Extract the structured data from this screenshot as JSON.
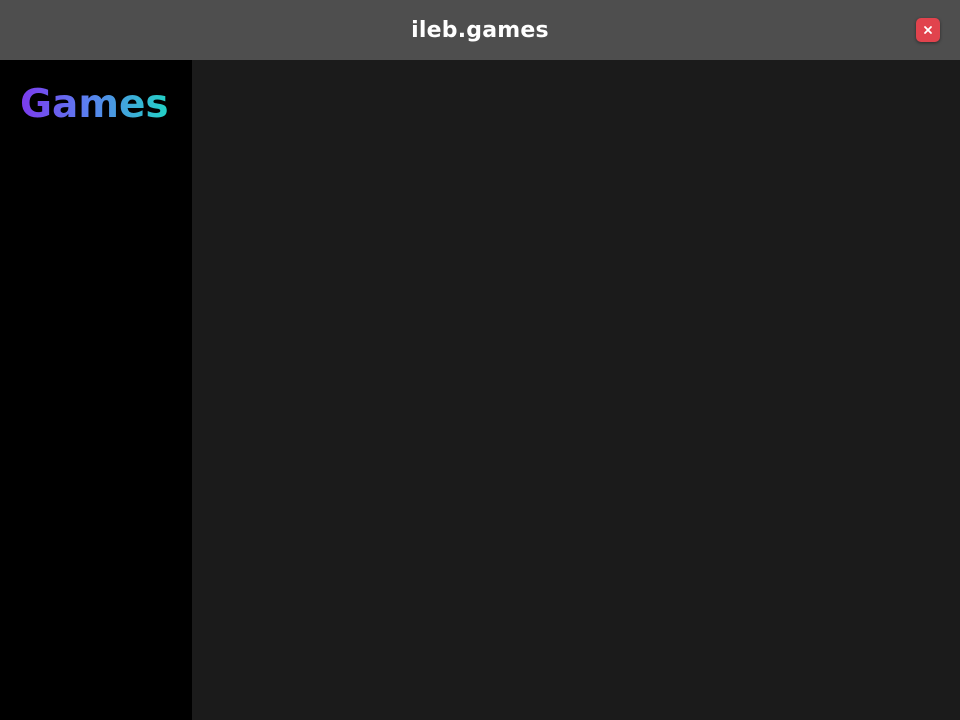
{
  "window": {
    "title": "ileb.games",
    "close_icon": "close-icon",
    "close_color": "#e1434d",
    "titlebar_color": "#4e4e4e"
  },
  "sidebar": {
    "brand": "Games",
    "brand_gradient": [
      "#7c3aed",
      "#22d3c5"
    ],
    "background": "#000000"
  },
  "main": {
    "background": "#1b1b1b"
  }
}
